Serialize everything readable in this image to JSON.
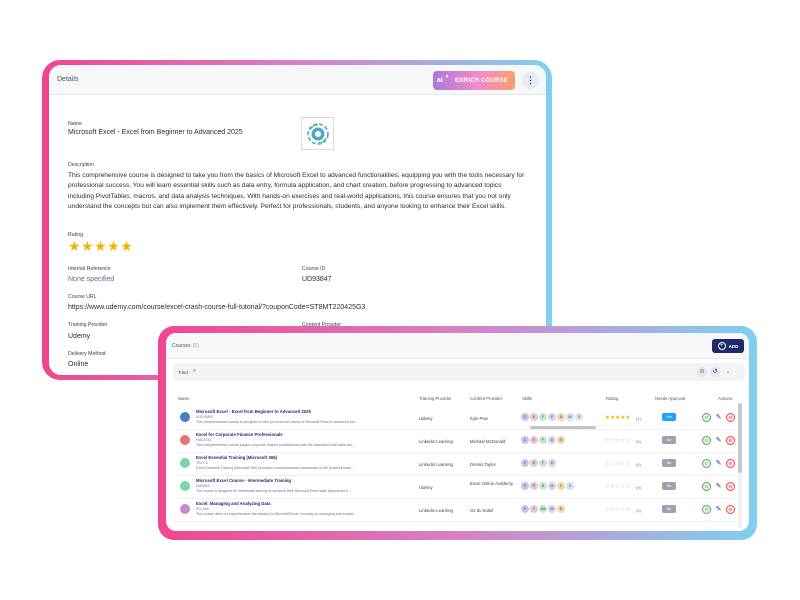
{
  "details": {
    "header_title": "Details",
    "enrich_button": "ENRICH COURSE",
    "enrich_icon_text": "ai",
    "more_icon": "kebab-icon",
    "name_label": "Name",
    "name_value": "Microsoft Excel - Excel from Beginner to Advanced 2025",
    "description_label": "Description",
    "description_value": "This comprehensive course is designed to take you from the basics of Microsoft Excel to advanced functionalities, equipping you with the tools necessary for professional success. You will learn essential skills such as data entry, formula application, and chart creation, before progressing to advanced topics including PivotTables, macros, and data analysis techniques. With hands-on exercises and real-world applications, this course ensures that you not only understand the concepts but can also implement them effectively. Perfect for professionals, students, and anyone looking to enhance their Excel skills.",
    "rating_label": "Rating",
    "rating_value": 5,
    "rating_stars": "★★★★★",
    "internal_ref_label": "Internal Reference",
    "internal_ref_value": "None specified",
    "course_id_label": "Course ID",
    "course_id_value": "UD93847",
    "course_url_label": "Course URL",
    "course_url_value": "https://www.udemy.com/course/excel-crash-course-full-tutorial/?couponCode=ST8MT220425G3",
    "training_provider_label": "Training Provider",
    "training_provider_value": "Udemy",
    "content_provider_label": "Content Provider",
    "delivery_method_label": "Delivery Method",
    "delivery_method_value": "Online",
    "colors": {
      "star": "#f5b301",
      "muted_value": "#5b6b8f"
    }
  },
  "courses": {
    "title": "Courses",
    "count": "(5)",
    "add_button": "ADD",
    "filter_label": "Find",
    "columns": [
      "Name",
      "Training Provider",
      "Content Provider",
      "Skills",
      "Rating",
      "Needs Approval",
      "Actions"
    ],
    "rows": [
      {
        "name": "Microsoft Excel - Excel from Beginner to Advanced 2025",
        "code": "AUD93847",
        "desc": "This comprehensive course is designed to take you from the basics of Microsoft Excel to advanced fun...",
        "training_provider": "Udemy",
        "content_provider": "Kyle Pew",
        "skills": [
          "C",
          "E",
          "F",
          "P",
          "D",
          "M",
          "S"
        ],
        "stars": "★★★★★",
        "rating": 5,
        "rating_count": "(1)",
        "approval": "Yes",
        "icon_color": "#4a7fc1"
      },
      {
        "name": "Excel for Corporate Finance Professionals",
        "code": "HUL8733",
        "desc": "This comprehensive course equips corporate finance professionals with the essential Excel skills nec...",
        "training_provider": "Linkedin Learning",
        "content_provider": "Michael McDonald",
        "skills": [
          "C",
          "E",
          "F",
          "D",
          "M"
        ],
        "stars": "☆☆☆☆☆",
        "rating": 0,
        "rating_count": "(0)",
        "approval": "No",
        "icon_color": "#e57373"
      },
      {
        "name": "Excel Essential Training (Microsoft 365)",
        "code": "TEL7-0",
        "desc": "Excel Essential Training (Microsoft 365) provides a comprehensive introduction to the powerful featu...",
        "training_provider": "Linkedin Learning",
        "content_provider": "Dennis Taylor",
        "skills": [
          "C",
          "E",
          "F",
          "D"
        ],
        "stars": "☆☆☆☆☆",
        "rating": 0,
        "rating_count": "(0)",
        "approval": "No",
        "icon_color": "#7ed6a8"
      },
      {
        "name": "Microsoft Excel Course - Intermediate Training",
        "code": "HUE803",
        "desc": "The course is designed for individuals seeking to enhance their Microsoft Excel skills beyond the b...",
        "training_provider": "Udemy",
        "content_provider": "Excel Online Academy",
        "skills": [
          "F",
          "P",
          "D",
          "M",
          "C",
          "V"
        ],
        "stars": "☆☆☆☆☆",
        "rating": 0,
        "rating_count": "(0)",
        "approval": "No",
        "icon_color": "#7ed6a8"
      },
      {
        "name": "Excel: Managing and Analyzing Data",
        "code": "PLL2A0",
        "desc": "The course offers a comprehensive introduction to Microsoft Excel, focusing on managing and analyzi...",
        "training_provider": "Linkedin Learning",
        "content_provider": "Oz du Soleil",
        "skills": [
          "P",
          "F",
          "DA",
          "M",
          "D"
        ],
        "stars": "☆☆☆☆☆",
        "rating": 0,
        "rating_count": "(0)",
        "approval": "No",
        "icon_color": "#c58ad0"
      }
    ],
    "colors": {
      "add_button": "#1f2a6b",
      "approval_yes": "#1aa3ff",
      "approval_no": "#9ca3af",
      "star": "#f5b301",
      "star_empty": "#b9bec7"
    }
  }
}
